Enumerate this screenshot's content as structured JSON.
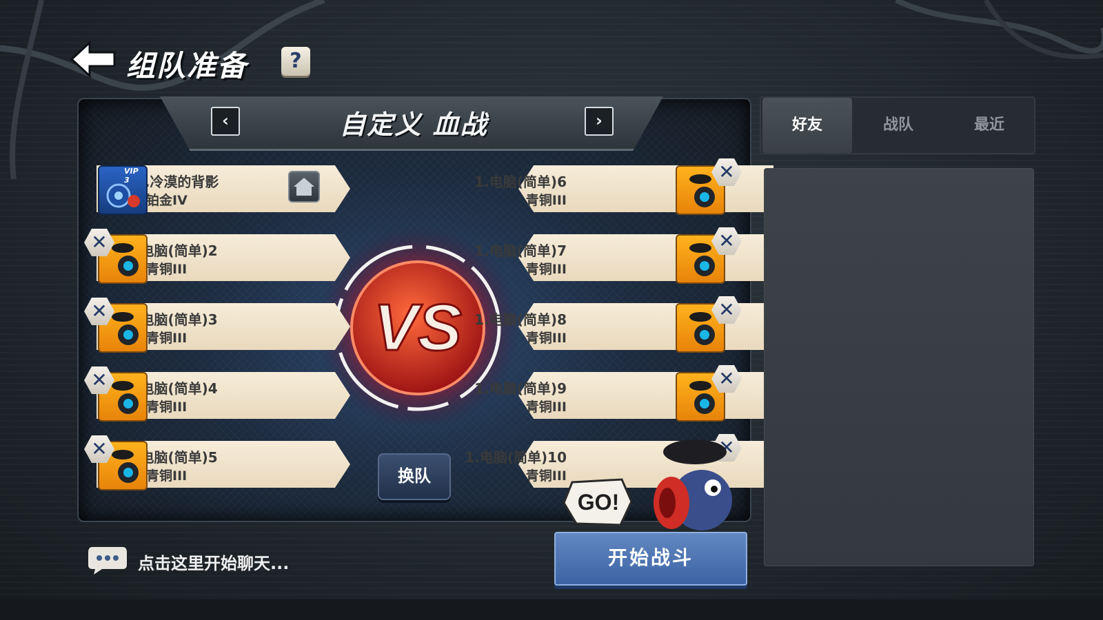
{
  "header": {
    "title": "组队准备",
    "help_label": "?"
  },
  "mode": {
    "title": "自定义 血战",
    "prev_label": "‹",
    "next_label": "›"
  },
  "team_left": [
    {
      "name": "15.冷漠的背影",
      "rank": "铂金IV",
      "vip": "VIP 3",
      "is_host": true
    },
    {
      "name": "1.电脑(简单)2",
      "rank": "青铜III"
    },
    {
      "name": "1.电脑(简单)3",
      "rank": "青铜III"
    },
    {
      "name": "1.电脑(简单)4",
      "rank": "青铜III"
    },
    {
      "name": "1.电脑(简单)5",
      "rank": "青铜III"
    }
  ],
  "team_right": [
    {
      "name": "1.电脑(简单)6",
      "rank": "青铜III"
    },
    {
      "name": "1.电脑(简单)7",
      "rank": "青铜III"
    },
    {
      "name": "1.电脑(简单)8",
      "rank": "青铜III"
    },
    {
      "name": "1.电脑(简单)9",
      "rank": "青铜III"
    },
    {
      "name": "1.电脑(简单)10",
      "rank": "青铜III"
    }
  ],
  "remove_label": "✕",
  "vs_label": "VS",
  "swap_label": "换队",
  "start_label": "开始战斗",
  "go_label": "GO!",
  "chat": {
    "placeholder": "点击这里开始聊天..."
  },
  "side_tabs": [
    {
      "label": "好友",
      "active": true
    },
    {
      "label": "战队",
      "active": false
    },
    {
      "label": "最近",
      "active": false
    }
  ],
  "colors": {
    "accent_blue": "#4f77b6",
    "vs_red": "#d8322a",
    "plate": "#f3e7d2"
  },
  "icons": {
    "back": "back-arrow-icon",
    "home": "home-icon",
    "chat": "chat-bubble-icon",
    "remove": "close-icon"
  }
}
